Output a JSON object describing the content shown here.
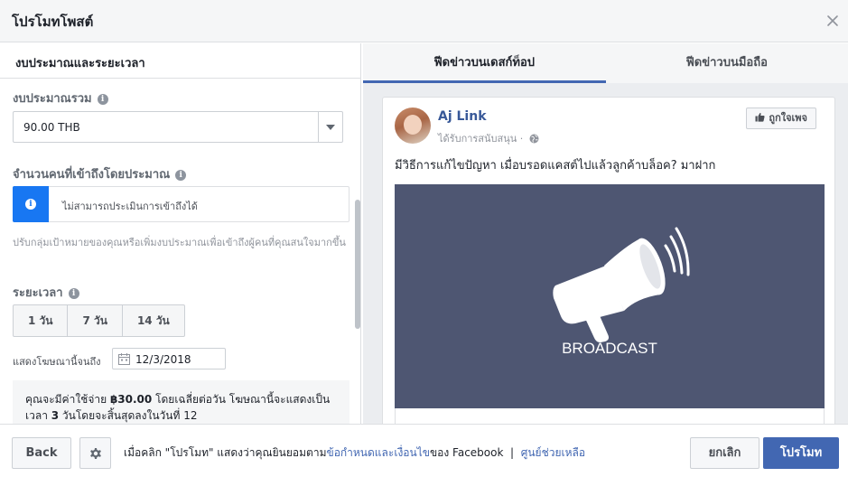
{
  "dialog": {
    "title": "โปรโมทโพสต์"
  },
  "left": {
    "section_title": "งบประมาณและระยะเวลา",
    "budget": {
      "label": "งบประมาณรวม",
      "value": "90.00 THB"
    },
    "reach": {
      "label": "จำนวนคนที่เข้าถึงโดยประมาณ",
      "message": "ไม่สามารถประเมินการเข้าถึงได้"
    },
    "help_text": "ปรับกลุ่มเป้าหมายของคุณหรือเพิ่มงบประมาณเพื่อเข้าถึงผู้คนที่คุณสนใจมากขึ้น",
    "duration": {
      "label": "ระยะเวลา",
      "options": [
        "1 วัน",
        "7 วัน",
        "14 วัน"
      ],
      "end_label": "แสดงโฆษณานี้จนถึง",
      "end_date": "12/3/2018"
    },
    "summary": {
      "prefix": "คุณจะมีค่าใช้จ่าย ",
      "amount": "฿30.00",
      "middle": " โดยเฉลี่ยต่อวัน โฆษณานี้จะแสดงเป็นเวลา ",
      "days": "3",
      "suffix": " วันโดยจะสิ้นสุดลงในวันที่ 12"
    }
  },
  "preview": {
    "tabs": [
      "ฟีดข่าวบนเดสก์ท็อป",
      "ฟีดข่าวบนมือถือ"
    ],
    "page_name": "Aj Link",
    "sponsored": "ได้รับการสนับสนุน ·",
    "like_page": "ถูกใจเพจ",
    "post_text": "มีวิธีการแก้ไขปัญหา เมื่อบรอดแคสต์ไปแล้วลูกค้าบล็อค? มาฝาก",
    "image_text": "BROADCAST",
    "image_bg": "#4e5672"
  },
  "footer": {
    "back": "Back",
    "terms_prefix": "เมื่อคลิก \"โปรโมท\" แสดงว่าคุณยินยอมตาม",
    "terms_link": "ข้อกำหนดและเงื่อนไข",
    "terms_suffix": "ของ Facebook  |  ",
    "help_link": "ศูนย์ช่วยเหลือ",
    "cancel": "ยกเลิก",
    "promote": "โปรโมท"
  },
  "colors": {
    "accent": "#4267b2",
    "info_blue": "#1877f2"
  }
}
